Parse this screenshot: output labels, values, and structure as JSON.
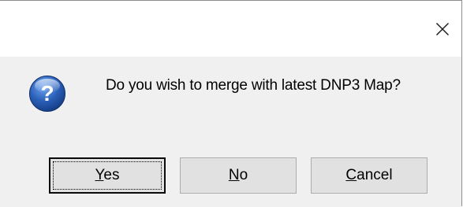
{
  "dialog": {
    "close_glyph": "✕",
    "message": "Do you wish to merge with latest DNP3 Map?",
    "icon": "question-icon",
    "icon_glyph": "?",
    "buttons": {
      "yes": {
        "mnemonic": "Y",
        "rest": "es"
      },
      "no": {
        "mnemonic": "N",
        "rest": "o"
      },
      "cancel": {
        "mnemonic": "C",
        "rest": "ancel"
      }
    }
  },
  "colors": {
    "icon_blue": "#2a5fb8",
    "dialog_background": "#f0f0f0",
    "button_face": "#e1e1e1"
  }
}
